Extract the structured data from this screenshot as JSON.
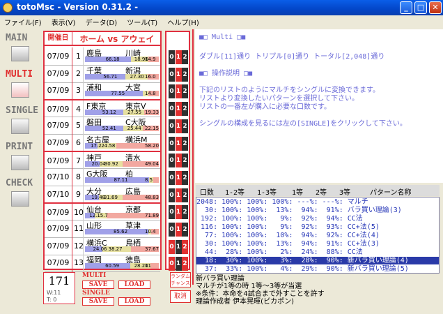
{
  "window": {
    "title": "totoMsc - Version 0.31.2 -",
    "min": "_",
    "max": "□",
    "close": "✕"
  },
  "menu": [
    "ファイル(F)",
    "表示(V)",
    "データ(D)",
    "ツール(T)",
    "ヘルプ(H)"
  ],
  "sidebar": {
    "main": "MAIN",
    "multi": "MULTI",
    "single": "SINGLE",
    "print": "PRINT",
    "check": "CHECK"
  },
  "match_header": {
    "date": "開催日",
    "teams": "ホーム vs アウェイ"
  },
  "matches": [
    {
      "date": "07/09",
      "no": "1",
      "home": "鹿島",
      "away": "川崎",
      "p": [
        "66.18",
        "18.96",
        "14.9"
      ],
      "f": [
        0.62,
        0.24,
        0.14
      ]
    },
    {
      "date": "07/09",
      "no": "2",
      "home": "千葉",
      "away": "新潟",
      "p": [
        "56.71",
        "27.30",
        "16.0"
      ],
      "f": [
        0.55,
        0.3,
        0.15
      ]
    },
    {
      "date": "07/09",
      "no": "3",
      "home": "浦和",
      "away": "大宮",
      "p": [
        "77.55",
        "",
        "14.8"
      ],
      "f": [
        0.78,
        0.08,
        0.14
      ]
    },
    {
      "date": "07/09",
      "no": "4",
      "home": "F東京",
      "away": "東京V",
      "p": [
        "53.12",
        "27.55",
        "19.33"
      ],
      "f": [
        0.52,
        0.28,
        0.2
      ]
    },
    {
      "date": "07/09",
      "no": "5",
      "home": "磐田",
      "away": "C大阪",
      "p": [
        "52.41",
        "25.44",
        "22.15"
      ],
      "f": [
        0.52,
        0.26,
        0.22
      ]
    },
    {
      "date": "07/09",
      "no": "6",
      "home": "名古屋",
      "away": "横浜M",
      "p": [
        "17.2",
        "24.58",
        "58.20"
      ],
      "f": [
        0.17,
        0.25,
        0.58
      ]
    },
    {
      "date": "07/09",
      "no": "7",
      "home": "神戸",
      "away": "清水",
      "p": [
        "20.04",
        "30.92",
        "49.04"
      ],
      "f": [
        0.2,
        0.31,
        0.49
      ]
    },
    {
      "date": "07/10",
      "no": "8",
      "home": "G大阪",
      "away": "柏",
      "p": [
        "87.11",
        "",
        "8.5"
      ],
      "f": [
        0.87,
        0.05,
        0.08
      ]
    },
    {
      "date": "07/10",
      "no": "9",
      "home": "大分",
      "away": "広島",
      "p": [
        "19.48",
        "31.69",
        "48.83"
      ],
      "f": [
        0.19,
        0.32,
        0.49
      ]
    },
    {
      "date": "07/09",
      "no": "10",
      "home": "仙台",
      "away": "京都",
      "p": [
        "12.15.7",
        "",
        "71.89"
      ],
      "f": [
        0.13,
        0.16,
        0.71
      ]
    },
    {
      "date": "07/09",
      "no": "11",
      "home": "山形",
      "away": "草津",
      "p": [
        "85.62",
        "",
        "10.4"
      ],
      "f": [
        0.86,
        0.04,
        0.1
      ]
    },
    {
      "date": "07/09",
      "no": "12",
      "home": "横浜C",
      "away": "鳥栖",
      "p": [
        "24.06",
        "38.27",
        "37.67"
      ],
      "f": [
        0.24,
        0.38,
        0.38
      ]
    },
    {
      "date": "07/09",
      "no": "13",
      "home": "福岡",
      "away": "徳島",
      "p": [
        "60.59",
        "28.20",
        "11"
      ],
      "f": [
        0.61,
        0.28,
        0.11
      ]
    }
  ],
  "picks": [
    [
      "0",
      "1",
      "2"
    ],
    [
      "0",
      "1",
      "2"
    ],
    [
      "0",
      "1",
      "2"
    ],
    [
      "0",
      "1",
      "2"
    ],
    [
      "0",
      "1",
      "2"
    ],
    [
      "0",
      "1",
      "2"
    ],
    [
      "0",
      "1",
      "2"
    ],
    [
      "0",
      "1",
      "2"
    ],
    [
      "0",
      "1",
      "2"
    ],
    [
      "0",
      "1",
      "2"
    ],
    [
      "0",
      "1",
      "2"
    ],
    [
      "0",
      "1",
      "2"
    ],
    [
      "0",
      "1",
      "2"
    ]
  ],
  "picks_on": [
    [
      false,
      true,
      false
    ],
    [
      false,
      true,
      false
    ],
    [
      false,
      true,
      false
    ],
    [
      false,
      true,
      false
    ],
    [
      false,
      true,
      false
    ],
    [
      false,
      true,
      false
    ],
    [
      false,
      true,
      false
    ],
    [
      false,
      true,
      false
    ],
    [
      false,
      true,
      false
    ],
    [
      false,
      true,
      false
    ],
    [
      false,
      true,
      false
    ],
    [
      true,
      false,
      true
    ],
    [
      true,
      false,
      true
    ]
  ],
  "info": {
    "title": "■□ Multi □■",
    "counts": "ダブル[11]通り トリプル[0]通り トータル[2,048]通り",
    "howto": "■□ 操作説明 □■",
    "desc1": "下記のリストのようにマルチをシングルに変換できます。",
    "desc2": "リストより変換したいパターンを選択して下さい。",
    "desc3": "リストの一番左が購入に必要な口数です。",
    "desc4": "シングルの構成を見るには左の[SINGLE]をクリックして下さい。"
  },
  "table": {
    "headers": [
      "口数",
      "1-2等",
      "1-3等",
      "1等",
      "2等",
      "3等",
      "パターン名称"
    ],
    "rows": [
      "2048: 100%: 100%: 100%: ---%: ---%: マルチ",
      "  30: 100%: 100%:  13%:  94%:  91%: バラ買い理論(3)",
      " 192: 100%: 100%:   9%:  92%:  94%: CC法",
      " 116: 100%: 100%:   9%:  92%:  93%: CC+法(5)",
      "  77: 100%: 100%:  10%:  94%:  92%: CC+法(4)",
      "  30: 100%: 100%:  13%:  94%:  91%: CC+法(3)",
      "  44:  28%: 100%:   2%:  24%:  88%: CC法",
      "  18:  30%: 100%:   3%:  28%:  90%: 新バラ買い理論(4)",
      "  37:  33%: 100%:   4%:  29%:  90%: 新バラ買い理論(5)"
    ],
    "selected": 7
  },
  "pattern_desc": [
    "新バラ買い理論",
    "マルチが1等の時 1等〜3等が当選",
    "※条件：本命を4試合まで外すことを許す",
    "理論作成者 伊本晃暉(ピカポン)"
  ],
  "bottom": {
    "count": "171",
    "w": "W:11",
    "t": "T: 0",
    "multi": "MULTI",
    "single": "SINGLE",
    "save": "SAVE",
    "load": "LOAD",
    "random": "ランダム\nチャンス",
    "cancel": "取消"
  }
}
